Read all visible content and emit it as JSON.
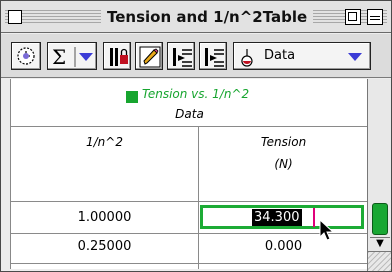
{
  "window": {
    "title": "Tension and 1/n^2Table"
  },
  "toolbar": {
    "buttons": [
      {
        "name": "clock-icon"
      },
      {
        "name": "sigma-icon"
      },
      {
        "name": "lock-icon"
      },
      {
        "name": "pencil-icon"
      },
      {
        "name": "insert-row-icon"
      },
      {
        "name": "append-row-icon"
      }
    ],
    "data_menu_label": "Data"
  },
  "table": {
    "legend": "Tension vs. 1/n^2",
    "legend_color": "#17a52f",
    "data_set_label": "Data",
    "columns": [
      {
        "header": "1/n^2",
        "unit": ""
      },
      {
        "header": "Tension",
        "unit": "(N)"
      }
    ],
    "rows": [
      {
        "x": "1.00000",
        "tension": "34.300",
        "editing": true
      },
      {
        "x": "0.25000",
        "tension": "0.000",
        "editing": false
      }
    ]
  },
  "colors": {
    "accent_green": "#1cab35",
    "cursor_magenta": "#e0007a"
  }
}
